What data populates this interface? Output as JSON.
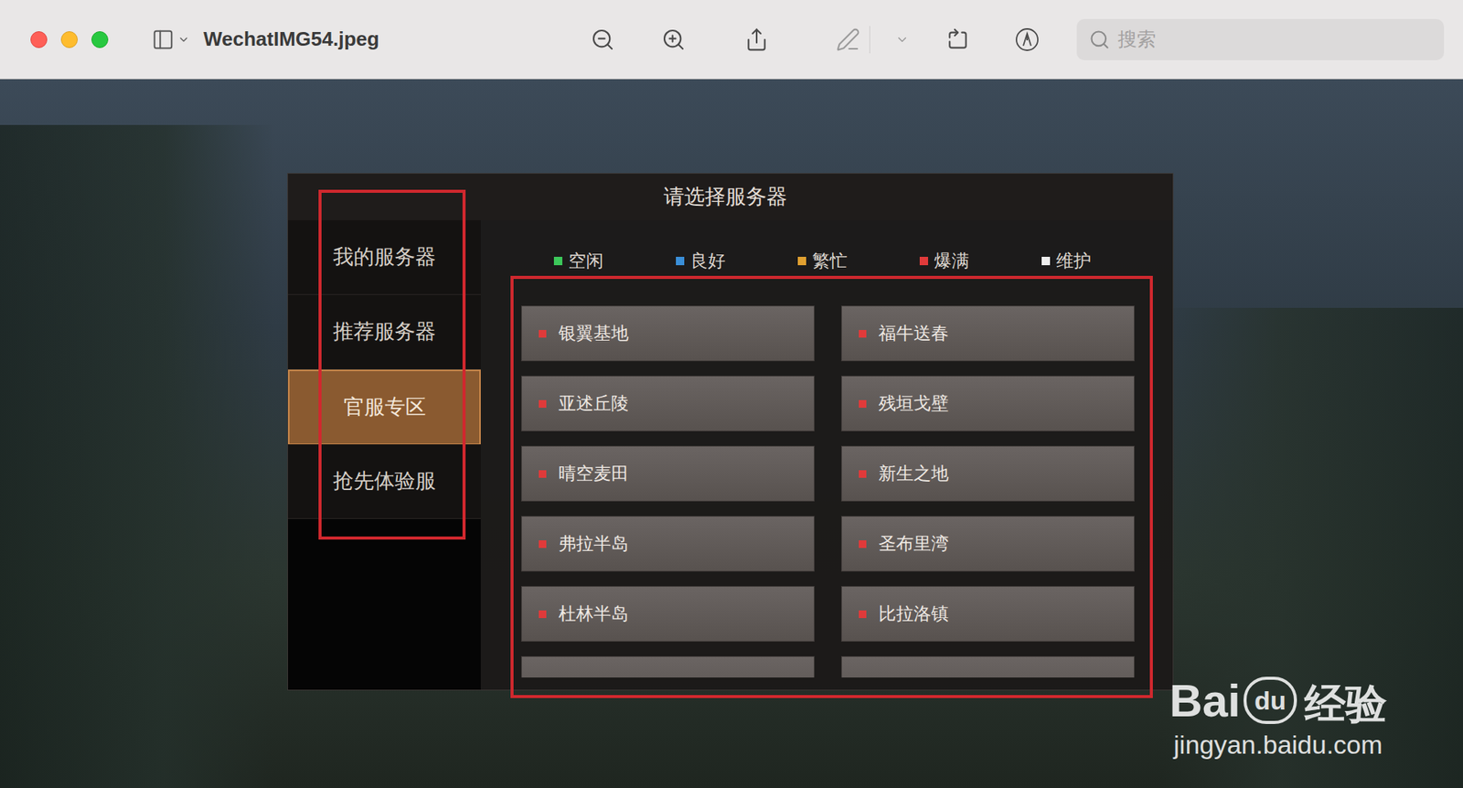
{
  "window": {
    "title": "WechatIMG54.jpeg"
  },
  "search": {
    "placeholder": "搜索"
  },
  "dialog": {
    "title": "请选择服务器"
  },
  "sidebar": {
    "items": [
      {
        "label": "我的服务器",
        "selected": false
      },
      {
        "label": "推荐服务器",
        "selected": false
      },
      {
        "label": "官服专区",
        "selected": true
      },
      {
        "label": "抢先体验服",
        "selected": false
      }
    ]
  },
  "legend": [
    {
      "label": "空闲",
      "color": "#3cc85a"
    },
    {
      "label": "良好",
      "color": "#3a8fd8"
    },
    {
      "label": "繁忙",
      "color": "#e0a030"
    },
    {
      "label": "爆满",
      "color": "#e03a3a"
    },
    {
      "label": "维护",
      "color": "#eeeeee"
    }
  ],
  "servers": [
    {
      "name": "银翼基地",
      "color": "#e03a3a"
    },
    {
      "name": "福牛送春",
      "color": "#e03a3a"
    },
    {
      "name": "亚述丘陵",
      "color": "#e03a3a"
    },
    {
      "name": "残垣戈壁",
      "color": "#e03a3a"
    },
    {
      "name": "晴空麦田",
      "color": "#e03a3a"
    },
    {
      "name": "新生之地",
      "color": "#e03a3a"
    },
    {
      "name": "弗拉半岛",
      "color": "#e03a3a"
    },
    {
      "name": "圣布里湾",
      "color": "#e03a3a"
    },
    {
      "name": "杜林半岛",
      "color": "#e03a3a"
    },
    {
      "name": "比拉洛镇",
      "color": "#e03a3a"
    }
  ],
  "watermark": {
    "brand": "Bai",
    "logo": "du",
    "product": "经验",
    "url": "jingyan.baidu.com"
  }
}
